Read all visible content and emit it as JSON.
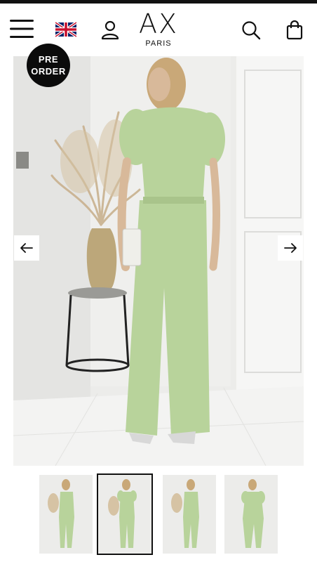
{
  "header": {
    "logo_mark": "AX",
    "logo_sub": "PARIS",
    "menu_icon": "hamburger-menu-icon",
    "flag_icon": "uk-flag-icon",
    "account_icon": "user-icon",
    "search_icon": "search-icon",
    "bag_icon": "shopping-bag-icon"
  },
  "product": {
    "badge_line1": "PRE",
    "badge_line2": "ORDER",
    "prev_icon": "arrow-left-icon",
    "next_icon": "arrow-right-icon",
    "garment_color": "#b8d39b"
  },
  "thumbnails": {
    "count": 4,
    "selected_index": 1
  }
}
